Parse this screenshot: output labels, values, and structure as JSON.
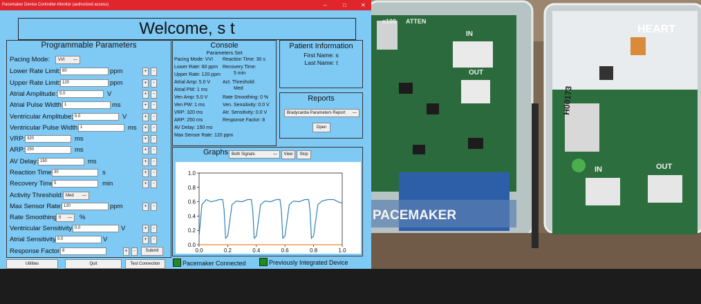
{
  "window": {
    "title": "Pacemaker Device Controller-Monitor (authorized access)",
    "minimize_icon": "minimize-icon",
    "maximize_icon": "maximize-icon",
    "close_icon": "close-icon",
    "minimize_glyph": "–",
    "maximize_glyph": "□",
    "close_glyph": "✕"
  },
  "welcome": "Welcome, s t",
  "programmable": {
    "title": "Programmable Parameters",
    "pacing_mode_label": "Pacing Mode:",
    "pacing_mode_value": "VVI",
    "lower_rate_label": "Lower Rate Limit:",
    "lower_rate_value": "60",
    "lower_rate_unit": "ppm",
    "upper_rate_label": "Upper Rate Limit:",
    "upper_rate_value": "120",
    "upper_rate_unit": "ppm",
    "atrial_amp_label": "Atrial Amplitude:",
    "atrial_amp_value": "5.0",
    "atrial_amp_unit": "V",
    "atrial_pw_label": "Atrial Pulse Width:",
    "atrial_pw_value": "1",
    "atrial_pw_unit": "ms",
    "vent_amp_label": "Ventricular Amplitube:",
    "vent_amp_value": "5.0",
    "vent_amp_unit": "V",
    "vent_pw_label": "Ventricular Pulse Width:",
    "vent_pw_value": "1",
    "vent_pw_unit": "ms",
    "vrp_label": "VRP:",
    "vrp_value": "320",
    "vrp_unit": "ms",
    "arp_label": "ARP:",
    "arp_value": "250",
    "arp_unit": "ms",
    "av_delay_label": "AV Delay:",
    "av_delay_value": "150",
    "av_delay_unit": "ms",
    "reaction_label": "Reaction Time:",
    "reaction_value": "30",
    "reaction_unit": "s",
    "recovery_label": "Recovery Time:",
    "recovery_value": "5",
    "recovery_unit": "min",
    "activity_label": "Activity Threshold:",
    "activity_value": "Med",
    "max_sensor_label": "Max Sensor Rate:",
    "max_sensor_value": "120",
    "max_sensor_unit": "ppm",
    "smoothing_label": "Rate Smoothing:",
    "smoothing_value": "0",
    "smoothing_unit": "%",
    "vent_sens_label": "Ventricular Sensitivity:",
    "vent_sens_value": "0.0",
    "vent_sens_unit": "V",
    "atr_sens_label": "Atrial Sensitivity:",
    "atr_sens_value": "0.0",
    "atr_sens_unit": "V",
    "response_label": "Response Factor:",
    "response_value": "8",
    "plus": "+",
    "minus": "-",
    "submit": "Submit"
  },
  "console": {
    "title": "Console",
    "subtitle": "Parameters Set",
    "left": [
      "Pacing Mode: VVI",
      "Lower Rate: 60 ppm",
      "Upper Rate: 120 ppm",
      "Atrial Amp: 5.0 V",
      "Atrial PW: 1 ms",
      "Ven Amp: 5.0 V",
      "Ven PW: 1 ms",
      "VRP: 320 ms",
      "ARP: 250 ms",
      "AV Delay: 150 ms",
      "Max Sensor Rate: 120 ppm"
    ],
    "right": [
      "Reaction Time: 30 s",
      "Recovery Time:",
      "5 min",
      "Act. Threshold:",
      "Med",
      "Rate Smoothing: 0 %",
      "Ven. Sensitivity: 0.0 V",
      "Atr. Sensitivity: 0.0 V",
      "Response Factor: 8"
    ]
  },
  "patient": {
    "title": "Patient Information",
    "first_name": "First Name: s",
    "last_name": "Last Name: t"
  },
  "reports": {
    "title": "Reports",
    "select_value": "Bradycardia Parameters Report",
    "open": "Open"
  },
  "graphs": {
    "title": "Graphs",
    "signal_select": "Both Signals",
    "view": "View",
    "stop": "Stop"
  },
  "chart_data": {
    "type": "line",
    "xlim": [
      0.0,
      1.0
    ],
    "ylim": [
      0.0,
      1.0
    ],
    "xticks": [
      "0.0",
      "0.2",
      "0.4",
      "0.6",
      "0.8",
      "1.0"
    ],
    "yticks": [
      "0.0",
      "0.2",
      "0.4",
      "0.6",
      "0.8",
      "1.0"
    ],
    "grid": false,
    "series": [
      {
        "color": "#2f7fb5",
        "x": [
          0.0,
          0.02,
          0.05,
          0.08,
          0.11,
          0.14,
          0.165,
          0.175,
          0.185,
          0.2,
          0.23,
          0.26,
          0.3,
          0.34,
          0.365,
          0.375,
          0.385,
          0.4,
          0.43,
          0.46,
          0.5,
          0.54,
          0.565,
          0.575,
          0.585,
          0.6,
          0.63,
          0.66,
          0.7,
          0.74,
          0.765,
          0.775,
          0.785,
          0.8,
          0.83,
          0.86,
          0.9,
          0.94,
          0.98,
          1.0
        ],
        "y": [
          0.12,
          0.56,
          0.63,
          0.6,
          0.61,
          0.63,
          0.63,
          0.48,
          0.09,
          0.12,
          0.56,
          0.61,
          0.6,
          0.63,
          0.63,
          0.48,
          0.09,
          0.12,
          0.56,
          0.61,
          0.6,
          0.63,
          0.63,
          0.48,
          0.09,
          0.12,
          0.56,
          0.61,
          0.6,
          0.63,
          0.63,
          0.48,
          0.09,
          0.12,
          0.56,
          0.61,
          0.63,
          0.63,
          0.59,
          0.58
        ]
      },
      {
        "color": "#e88a2c",
        "x": [
          0.0,
          1.0
        ],
        "y": [
          0.0,
          0.0
        ]
      }
    ]
  },
  "footer": {
    "utilities": "Utilities",
    "quit": "Quit",
    "test_connection": "Test Connection",
    "connected": "Pacemaker Connected",
    "integrated": "Previously Integrated Device",
    "indicator_color": "#1e8c1e"
  },
  "photo": {
    "board_label_1": "x100",
    "board_label_2": "ATTEN",
    "in_label_1": "IN",
    "out_label_1": "OUT",
    "heart_label": "HEART",
    "board_id": "H00173",
    "in_label_2": "IN",
    "out_label_2": "OUT",
    "pacemaker_label": "PACEMAKER"
  }
}
